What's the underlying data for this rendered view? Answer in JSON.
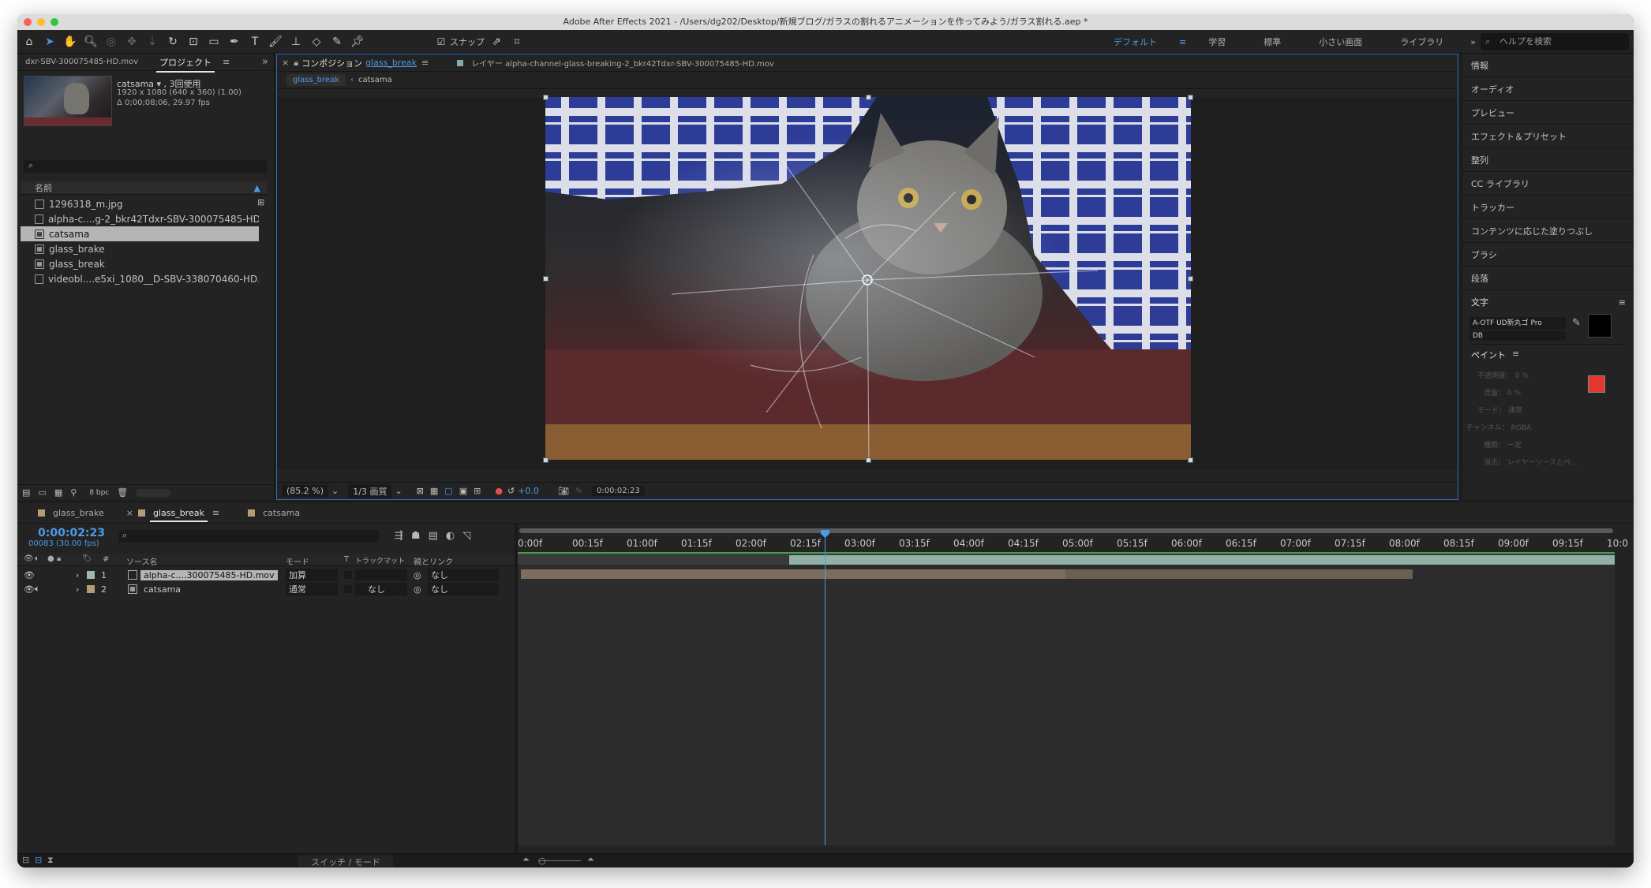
{
  "app": {
    "title": "Adobe After Effects 2021 - /Users/dg202/Desktop/新規ブログ/ガラスの割れるアニメーションを作ってみよう/ガラス割れる.aep *"
  },
  "toolbar": {
    "snap_label": "スナップ",
    "workspaces": [
      "デフォルト",
      "学習",
      "標準",
      "小さい画面",
      "ライブラリ"
    ],
    "active_workspace": "デフォルト",
    "search_placeholder": "ヘルプを検索"
  },
  "project": {
    "footage_tab": "dxr-SBV-300075485-HD.mov",
    "tab_label": "プロジェクト",
    "selected_name": "catsama ▾ , 3回使用",
    "selected_info1": "1920 x 1080  (640 x 360) (1.00)",
    "selected_info2": "Δ 0;00;08;06, 29.97 fps",
    "column_name": "名前",
    "items": [
      {
        "name": "1296318_m.jpg",
        "kind": "file"
      },
      {
        "name": "alpha-c....g-2_bkr42Tdxr-SBV-300075485-HD.mov",
        "kind": "file"
      },
      {
        "name": "catsama",
        "kind": "comp",
        "selected": true
      },
      {
        "name": "glass_brake",
        "kind": "comp"
      },
      {
        "name": "glass_break",
        "kind": "comp"
      },
      {
        "name": "videobl....e5xi_1080__D-SBV-338070460-HD.mp4",
        "kind": "file"
      }
    ],
    "bpc": "8 bpc"
  },
  "composition": {
    "tab_label": "コンポジション",
    "tab_comp": "glass_break",
    "layer_tab": "レイヤー alpha-channel-glass-breaking-2_bkr42Tdxr-SBV-300075485-HD.mov",
    "breadcrumb": [
      "glass_break",
      "catsama"
    ],
    "zoom": "(85.2 %)",
    "resolution": "1/3 画質",
    "exposure": "+0.0",
    "timecode": "0:00:02:23"
  },
  "right_panel": {
    "items": [
      "情報",
      "オーディオ",
      "プレビュー",
      "エフェクト＆プリセット",
      "整列",
      "CC ライブラリ",
      "トラッカー",
      "コンテンツに応じた塗りつぶし",
      "ブラシ",
      "段落"
    ],
    "text_section": "文字",
    "font": "A-OTF UD新丸ゴ Pro",
    "font_style": "DB",
    "paint_section": "ペイント",
    "paint_opacity_label": "不透明度：",
    "paint_opacity_value": "0 %",
    "paint_flow_label": "流量：",
    "paint_flow_value": "0 %",
    "paint_mode_label": "モード：",
    "paint_mode_value": "通常",
    "paint_channel_label": "チャンネル：",
    "paint_channel_value": "RGBA",
    "paint_duration_label": "種類：",
    "paint_duration_value": "一定",
    "paint_erase_label": "消去：",
    "paint_erase_value": "レイヤーソースとペ...",
    "paint_color": "#e0392b"
  },
  "timeline": {
    "tabs": [
      "glass_brake",
      "glass_break",
      "catsama"
    ],
    "active_tab": "glass_break",
    "timecode": "0:00:02:23",
    "frame_info": "00083 (30.00 fps)",
    "columns": {
      "source": "ソース名",
      "mode": "モード",
      "t": "T",
      "trackmatte": "トラックマット",
      "parent": "親とリンク"
    },
    "layers": [
      {
        "num": "1",
        "name": "alpha-c....300075485-HD.mov",
        "mode": "加算",
        "trackmatte": "",
        "parent": "なし",
        "selected": true
      },
      {
        "num": "2",
        "name": "catsama",
        "mode": "通常",
        "trackmatte": "なし",
        "parent": "なし",
        "selected": false
      }
    ],
    "ruler": [
      "0:00f",
      "00:15f",
      "01:00f",
      "01:15f",
      "02:00f",
      "02:15f",
      "03:00f",
      "03:15f",
      "04:00f",
      "04:15f",
      "05:00f",
      "05:15f",
      "06:00f",
      "06:15f",
      "07:00f",
      "07:15f",
      "08:00f",
      "08:15f",
      "09:00f",
      "09:15f",
      "10:0"
    ],
    "switch_mode_label": "スイッチ / モード"
  }
}
